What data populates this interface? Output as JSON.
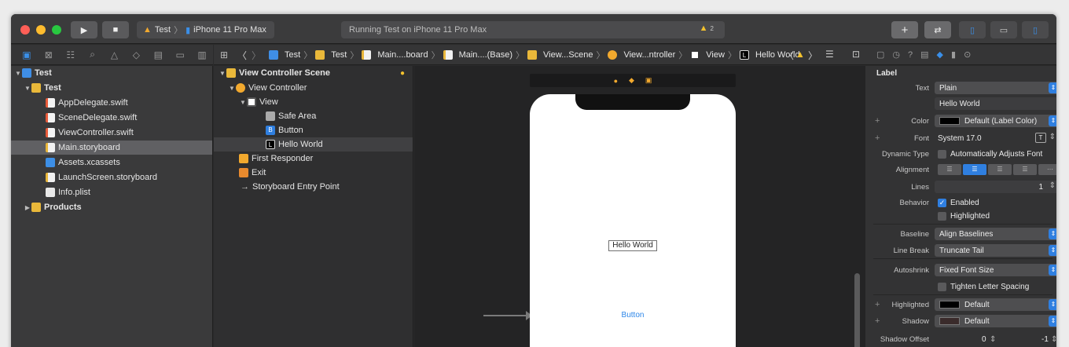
{
  "toolbar": {
    "run_icon": "play-icon",
    "stop_icon": "stop-icon",
    "scheme": "Test",
    "device": "iPhone 11 Pro Max",
    "status": "Running Test on iPhone 11 Pro Max",
    "warning_count": "2",
    "add_label": "+",
    "colors": {
      "close": "#ff5f57",
      "minimize": "#febc2e",
      "zoom": "#28c840",
      "accent": "#2f7fe0"
    }
  },
  "navigator": {
    "tabs": [
      "folder-icon",
      "source-control-icon",
      "symbol-icon",
      "find-icon",
      "issue-icon",
      "test-icon",
      "debug-icon",
      "breakpoint-icon",
      "report-icon"
    ],
    "items": [
      {
        "label": "Test",
        "icon": "project",
        "expanded": true,
        "depth": 0
      },
      {
        "label": "Test",
        "icon": "folder",
        "expanded": true,
        "depth": 1
      },
      {
        "label": "AppDelegate.swift",
        "icon": "swift",
        "depth": 2
      },
      {
        "label": "SceneDelegate.swift",
        "icon": "swift",
        "depth": 2
      },
      {
        "label": "ViewController.swift",
        "icon": "swift",
        "depth": 2
      },
      {
        "label": "Main.storyboard",
        "icon": "storyboard",
        "depth": 2,
        "selected": true
      },
      {
        "label": "Assets.xcassets",
        "icon": "xcassets",
        "depth": 2
      },
      {
        "label": "LaunchScreen.storyboard",
        "icon": "storyboard",
        "depth": 2
      },
      {
        "label": "Info.plist",
        "icon": "plist",
        "depth": 2
      },
      {
        "label": "Products",
        "icon": "folder",
        "expanded": false,
        "depth": 1
      }
    ]
  },
  "jumpbar": {
    "crumbs": [
      "Test",
      "Test",
      "Main....board",
      "Main....(Base)",
      "View...Scene",
      "View...ntroller",
      "View",
      "Hello World"
    ]
  },
  "outline": {
    "scene_title": "View Controller Scene",
    "items": [
      {
        "label": "View Controller",
        "depth": 1
      },
      {
        "label": "View",
        "depth": 2
      },
      {
        "label": "Safe Area",
        "depth": 3
      },
      {
        "label": "Button",
        "depth": 3
      },
      {
        "label": "Hello World",
        "depth": 3,
        "selected": true
      },
      {
        "label": "First Responder",
        "depth": 1
      },
      {
        "label": "Exit",
        "depth": 1
      },
      {
        "label": "Storyboard Entry Point",
        "depth": 1
      }
    ]
  },
  "canvas": {
    "label_text": "Hello World",
    "button_text": "Button"
  },
  "inspector": {
    "section": "Label",
    "text_type": "Plain",
    "text_value": "Hello World",
    "color": "Default (Label Color)",
    "font": "System 17.0",
    "dynamic_type": "Automatically Adjusts Font",
    "lines": "1",
    "behavior_enabled": "Enabled",
    "behavior_highlighted": "Highlighted",
    "baseline": "Align Baselines",
    "line_break": "Truncate Tail",
    "autoshrink": "Fixed Font Size",
    "tighten": "Tighten Letter Spacing",
    "highlighted": "Default",
    "shadow": "Default",
    "shadow_offset_w": "0",
    "shadow_offset_h": "-1",
    "labels": {
      "text": "Text",
      "color": "Color",
      "font": "Font",
      "dynamic_type": "Dynamic Type",
      "alignment": "Alignment",
      "lines": "Lines",
      "behavior": "Behavior",
      "baseline": "Baseline",
      "line_break": "Line Break",
      "autoshrink": "Autoshrink",
      "highlighted": "Highlighted",
      "shadow": "Shadow",
      "shadow_offset": "Shadow Offset"
    }
  }
}
